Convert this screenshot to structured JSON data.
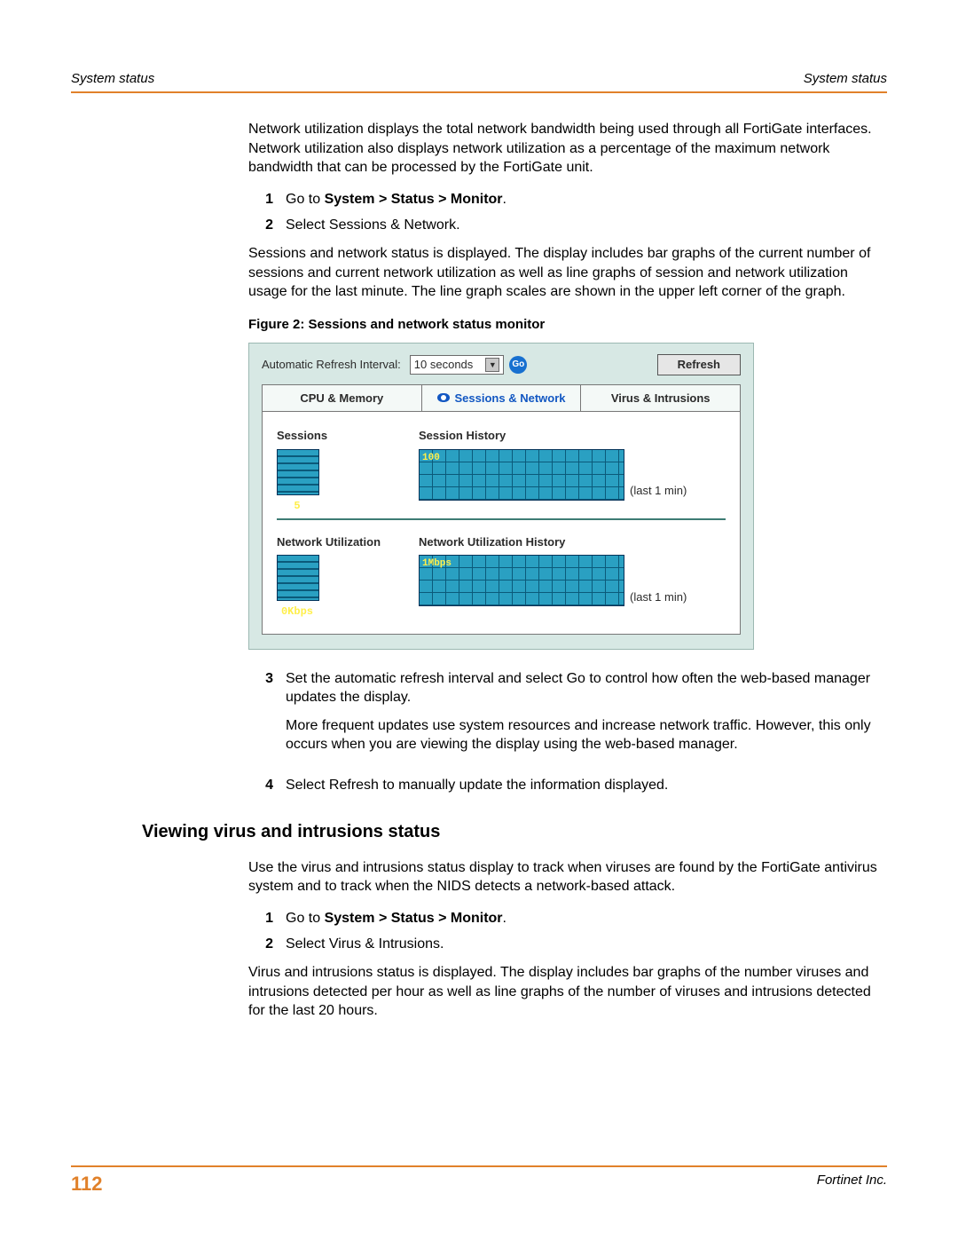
{
  "header": {
    "left": "System status",
    "right": "System status"
  },
  "intro": "Network utilization displays the total network bandwidth being used through all FortiGate interfaces. Network utilization also displays network utilization as a percentage of the maximum network bandwidth that can be processed by the FortiGate unit.",
  "steps_a": [
    {
      "num": "1",
      "prefix": "Go to ",
      "bold": "System > Status > Monitor",
      "suffix": "."
    },
    {
      "num": "2",
      "text": "Select Sessions & Network."
    }
  ],
  "sessions_para": "Sessions and network status is displayed. The display includes bar graphs of the current number of sessions and current network utilization as well as line graphs of session and network utilization usage for the last minute. The line graph scales are shown in the upper left corner of the graph.",
  "figure_caption": "Figure 2:   Sessions and network status monitor",
  "monitor": {
    "refresh_label": "Automatic Refresh Interval:",
    "interval_value": "10 seconds",
    "go": "Go",
    "refresh_btn": "Refresh",
    "tabs": {
      "cpu": "CPU & Memory",
      "sessions": "Sessions & Network",
      "virus": "Virus & Intrusions"
    },
    "sessions_title": "Sessions",
    "sessions_value": "5",
    "session_history_title": "Session History",
    "session_history_scale": "100",
    "session_history_last": "(last 1 min)",
    "netutil_title": "Network Utilization",
    "netutil_value": "0Kbps",
    "netutil_history_title": "Network Utilization History",
    "netutil_history_scale": "1Mbps",
    "netutil_history_last": "(last 1 min)"
  },
  "steps_b": [
    {
      "num": "3",
      "text": "Set the automatic refresh interval and select Go to control how often the web-based manager updates the display.",
      "follow": "More frequent updates use system resources and increase network traffic. However, this only occurs when you are viewing the display using the web-based manager."
    },
    {
      "num": "4",
      "text": "Select Refresh to manually update the information displayed."
    }
  ],
  "section_heading": "Viewing virus and intrusions status",
  "virus_intro": "Use the virus and intrusions status display to track when viruses are found by the FortiGate antivirus system and to track when the NIDS detects a network-based attack.",
  "steps_c": [
    {
      "num": "1",
      "prefix": "Go to ",
      "bold": "System > Status > Monitor",
      "suffix": "."
    },
    {
      "num": "2",
      "text": "Select Virus & Intrusions."
    }
  ],
  "virus_para": "Virus and intrusions status is displayed. The display includes bar graphs of the number viruses and intrusions detected per hour as well as line graphs of the number of viruses and intrusions detected for the last 20 hours.",
  "footer": {
    "page": "112",
    "company": "Fortinet Inc."
  }
}
